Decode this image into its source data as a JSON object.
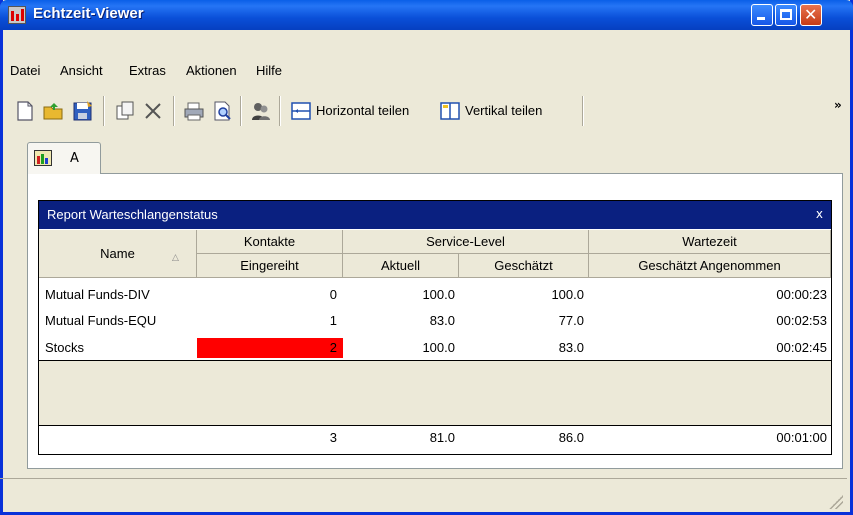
{
  "window": {
    "title": "Echtzeit-Viewer"
  },
  "menu": [
    {
      "label": "Datei"
    },
    {
      "label": "Ansicht"
    },
    {
      "label": "Extras"
    },
    {
      "label": "Aktionen"
    },
    {
      "label": "Hilfe"
    }
  ],
  "toolbar": {
    "horizontal_label": "Horizontal teilen",
    "vertical_label": "Vertikal teilen",
    "more": "»"
  },
  "tab": {
    "label": "A"
  },
  "report": {
    "title": "Report Warteschlangenstatus",
    "close": "x",
    "headers": {
      "name": "Name",
      "kontakte": "Kontakte",
      "service_level": "Service-Level",
      "wartezeit": "Wartezeit",
      "eingereiht": "Eingereiht",
      "aktuell": "Aktuell",
      "geschaetzt": "Geschätzt",
      "geschaetzt_angenommen": "Geschätzt Angenommen"
    },
    "rows": [
      {
        "name": "Mutual Funds-DIV",
        "eingereiht": "0",
        "aktuell": "100.0",
        "geschaetzt": "100.0",
        "wartezeit": "00:00:23"
      },
      {
        "name": "Mutual Funds-EQU",
        "eingereiht": "1",
        "aktuell": "83.0",
        "geschaetzt": "77.0",
        "wartezeit": "00:02:53"
      },
      {
        "name": "Stocks",
        "eingereiht": "2",
        "aktuell": "100.0",
        "geschaetzt": "83.0",
        "wartezeit": "00:02:45"
      }
    ],
    "totals": {
      "eingereiht": "3",
      "aktuell": "81.0",
      "geschaetzt": "86.0",
      "wartezeit": "00:01:00"
    },
    "alert_color": "#ff0000"
  }
}
